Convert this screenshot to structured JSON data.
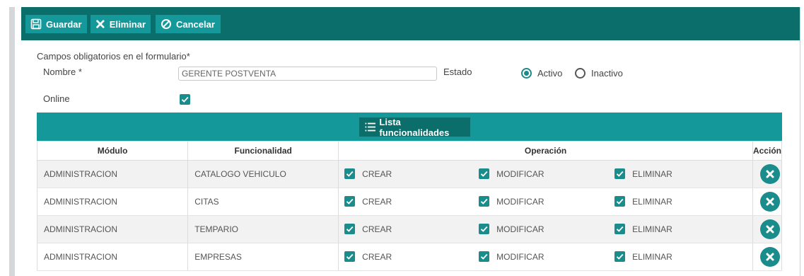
{
  "toolbar": {
    "save_label": "Guardar",
    "delete_label": "Eliminar",
    "cancel_label": "Cancelar"
  },
  "form": {
    "title": "Campos obligatorios en el formulario*",
    "nombre_label": "Nombre *",
    "nombre_value": "GERENTE POSTVENTA",
    "estado_label": "Estado",
    "estado_options": [
      "Activo",
      "Inactivo"
    ],
    "estado_selected": "Activo",
    "online_label": "Online",
    "online_checked": true
  },
  "list_button_label": "Lista funcionalidades",
  "table": {
    "headers": [
      "Módulo",
      "Funcionalidad",
      "Operación",
      "Acción"
    ],
    "rows": [
      {
        "modulo": "ADMINISTRACION",
        "funcionalidad": "CATALOGO VEHICULO",
        "ops": [
          "CREAR",
          "MODIFICAR",
          "ELIMINAR"
        ]
      },
      {
        "modulo": "ADMINISTRACION",
        "funcionalidad": "CITAS",
        "ops": [
          "CREAR",
          "MODIFICAR",
          "ELIMINAR"
        ]
      },
      {
        "modulo": "ADMINISTRACION",
        "funcionalidad": "TEMPARIO",
        "ops": [
          "CREAR",
          "MODIFICAR",
          "ELIMINAR"
        ]
      },
      {
        "modulo": "ADMINISTRACION",
        "funcionalidad": "EMPRESAS",
        "ops": [
          "CREAR",
          "MODIFICAR",
          "ELIMINAR"
        ]
      }
    ]
  },
  "colors": {
    "toolbar_bg": "#0b6e6a",
    "accent": "#14989a",
    "check": "#1a8c8c"
  },
  "icons": [
    "save-icon",
    "close-icon",
    "cancel-icon",
    "list-icon",
    "checkbox-checked-icon",
    "delete-circle-icon"
  ]
}
